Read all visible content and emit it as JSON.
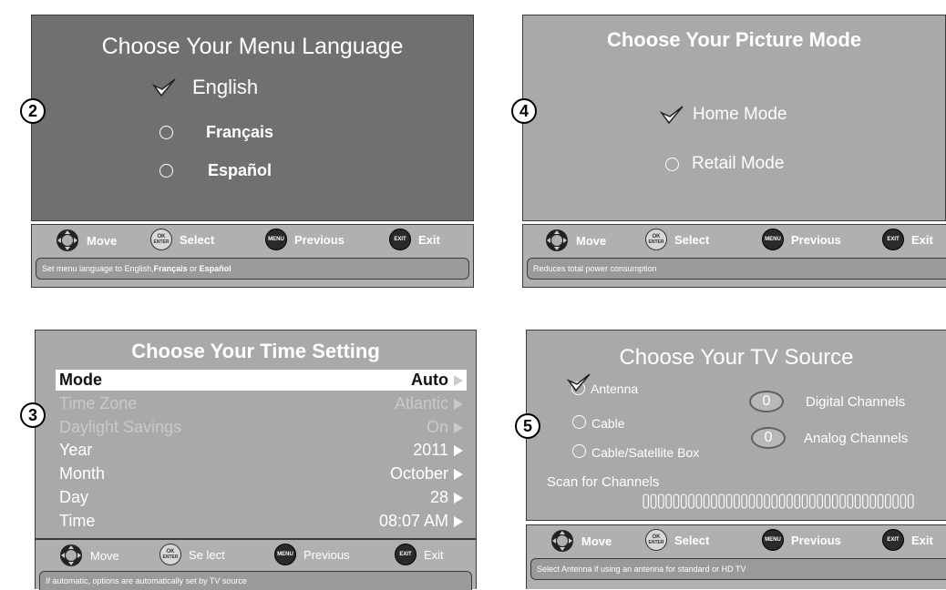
{
  "common_controls": {
    "move": "Move",
    "select": "Select",
    "previous": "Previous",
    "exit": "Exit",
    "ok_top": "OK",
    "ok_bottom": "ENTER",
    "menu_btn": "MENU",
    "exit_btn": "EXIT"
  },
  "panel2": {
    "step": "2",
    "title": "Choose Your Menu Language",
    "options": [
      "English",
      "Français",
      "Español"
    ],
    "selected_index": 0,
    "hint_prefix": "Set menu language to English, ",
    "hint_b1": "Français",
    "hint_mid": " or ",
    "hint_b2": "Español",
    "select_label": "Select"
  },
  "panel4": {
    "step": "4",
    "title": "Choose Your Picture Mode",
    "options": [
      "Home Mode",
      "Retail Mode"
    ],
    "selected_index": 0,
    "hint": "Reduces total power consumption"
  },
  "panel3": {
    "step": "3",
    "title": "Choose Your Time Setting",
    "rows": [
      {
        "label": "Mode",
        "value": "Auto"
      },
      {
        "label": "Time Zone",
        "value": "Atlantic"
      },
      {
        "label": "Daylight Savings",
        "value": "On"
      },
      {
        "label": "Year",
        "value": "2011"
      },
      {
        "label": "Month",
        "value": "October"
      },
      {
        "label": "Day",
        "value": "28"
      },
      {
        "label": "Time",
        "value": "08:07 AM"
      }
    ],
    "select_label": "Se lect",
    "hint": "If automatic, options are automatically set by TV source"
  },
  "panel5": {
    "step": "5",
    "title": "Choose Your TV Source",
    "options": [
      "Antenna",
      "Cable",
      "Cable/Satellite Box"
    ],
    "selected_index": 0,
    "digital_count": "0",
    "digital_label": "Digital Channels",
    "analog_count": "0",
    "analog_label": "Analog Channels",
    "scan_label": "Scan for Channels",
    "hint": "Select Antenna if using an antenna for standard or HD TV"
  }
}
